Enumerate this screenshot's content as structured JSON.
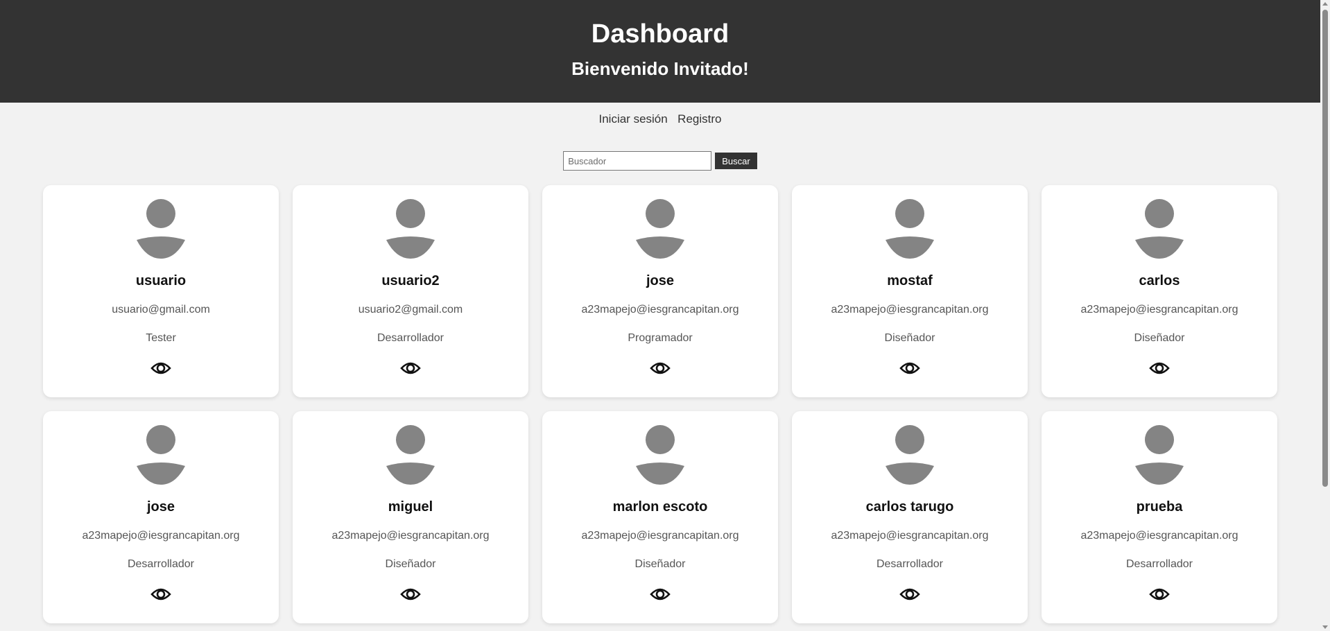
{
  "header": {
    "title": "Dashboard",
    "welcome": "Bienvenido Invitado!"
  },
  "nav": {
    "login": "Iniciar sesión",
    "register": "Registro"
  },
  "search": {
    "placeholder": "Buscador",
    "button": "Buscar"
  },
  "colors": {
    "header_bg": "#333333",
    "page_bg": "#f2f2f2",
    "card_bg": "#ffffff",
    "avatar": "#848484"
  },
  "icons": {
    "avatar": "user-avatar-icon",
    "view": "eye-icon"
  },
  "users": [
    {
      "name": "usuario",
      "email": "usuario@gmail.com",
      "role": "Tester"
    },
    {
      "name": "usuario2",
      "email": "usuario2@gmail.com",
      "role": "Desarrollador"
    },
    {
      "name": "jose",
      "email": "a23mapejo@iesgrancapitan.org",
      "role": "Programador"
    },
    {
      "name": "mostaf",
      "email": "a23mapejo@iesgrancapitan.org",
      "role": "Diseñador"
    },
    {
      "name": "carlos",
      "email": "a23mapejo@iesgrancapitan.org",
      "role": "Diseñador"
    },
    {
      "name": "jose",
      "email": "a23mapejo@iesgrancapitan.org",
      "role": "Desarrollador"
    },
    {
      "name": "miguel",
      "email": "a23mapejo@iesgrancapitan.org",
      "role": "Diseñador"
    },
    {
      "name": "marlon escoto",
      "email": "a23mapejo@iesgrancapitan.org",
      "role": "Diseñador"
    },
    {
      "name": "carlos tarugo",
      "email": "a23mapejo@iesgrancapitan.org",
      "role": "Desarrollador"
    },
    {
      "name": "prueba",
      "email": "a23mapejo@iesgrancapitan.org",
      "role": "Desarrollador"
    }
  ]
}
